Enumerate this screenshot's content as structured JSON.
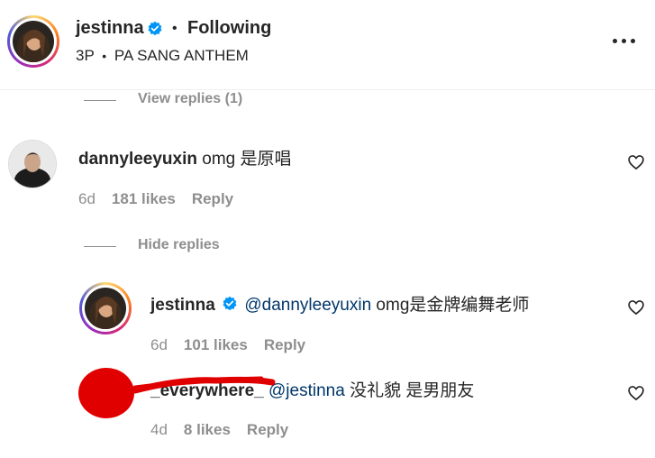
{
  "post": {
    "username": "jestinna",
    "follow_status": "Following",
    "time": "3P",
    "audio": "PA SANG ANTHEM",
    "separator": "•"
  },
  "view_replies": "View replies (1)",
  "hide_replies": "Hide replies",
  "comments": [
    {
      "username": "dannyleeyuxin",
      "text": "omg 是原唱",
      "time": "6d",
      "likes": "181 likes",
      "reply": "Reply"
    }
  ],
  "replies": [
    {
      "username": "jestinna",
      "mention": "@dannyleeyuxin",
      "text": "omg是金牌编舞老师",
      "time": "6d",
      "likes": "101 likes",
      "reply": "Reply"
    },
    {
      "username": "_everywhere_",
      "mention": "@jestinna",
      "text": "没礼貌 是男朋友",
      "time": "4d",
      "likes": "8 likes",
      "reply": "Reply"
    }
  ],
  "colors": {
    "verified_blue": "#0095f6",
    "mention_blue": "#00376b",
    "muted_grey": "#8e8e8e",
    "redaction_red": "#e00000"
  }
}
